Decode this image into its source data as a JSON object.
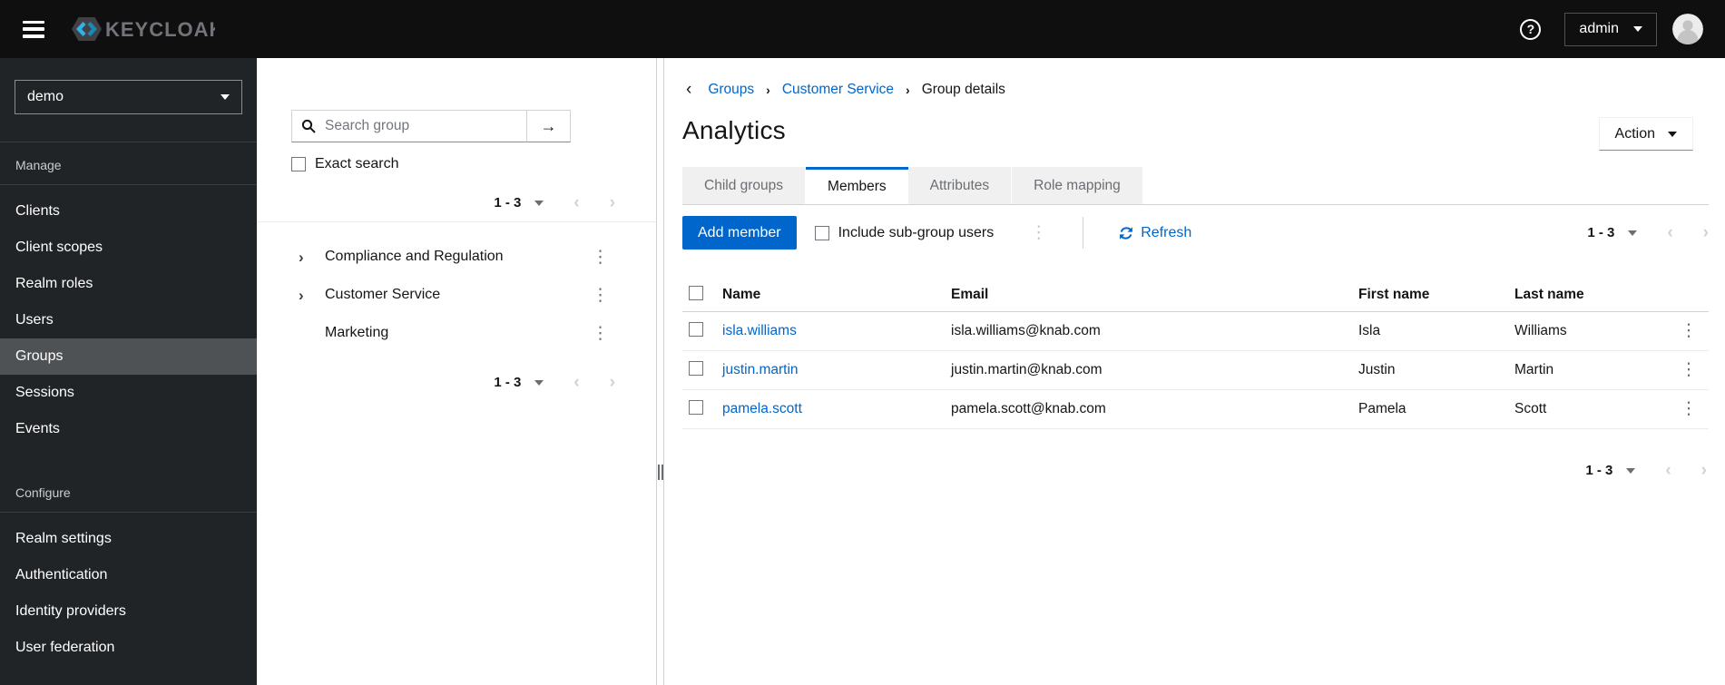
{
  "topbar": {
    "brand": "KEYCLOAK",
    "user": "admin"
  },
  "icons": {
    "kebab": "⋮",
    "angle_right": "›",
    "angle_left": "‹",
    "arrow_right": "→",
    "help": "?"
  },
  "sidebar": {
    "realm": "demo",
    "sections": {
      "manage": {
        "label": "Manage",
        "items": [
          "Clients",
          "Client scopes",
          "Realm roles",
          "Users",
          "Groups",
          "Sessions",
          "Events"
        ]
      },
      "configure": {
        "label": "Configure",
        "items": [
          "Realm settings",
          "Authentication",
          "Identity providers",
          "User federation"
        ]
      }
    },
    "active_item": "Groups"
  },
  "drawer": {
    "search": {
      "placeholder": "Search group"
    },
    "exact_search_label": "Exact search",
    "pagination": {
      "range": "1 - 3"
    },
    "tree": {
      "items": [
        {
          "label": "Compliance and Regulation",
          "expandable": true
        },
        {
          "label": "Customer Service",
          "expandable": true
        },
        {
          "label": "Marketing",
          "expandable": false
        }
      ]
    }
  },
  "main": {
    "breadcrumb": {
      "items": [
        "Groups",
        "Customer Service",
        "Group details"
      ]
    },
    "title": "Analytics",
    "action_label": "Action",
    "tabs": {
      "items": [
        "Child groups",
        "Members",
        "Attributes",
        "Role mapping"
      ],
      "active": "Members"
    },
    "toolbar": {
      "add_member_label": "Add member",
      "include_subgroups_label": "Include sub-group users",
      "refresh_label": "Refresh",
      "pagination": {
        "range": "1 - 3"
      }
    },
    "table": {
      "headers": [
        "Name",
        "Email",
        "First name",
        "Last name"
      ],
      "rows": [
        {
          "name": "isla.williams",
          "email": "isla.williams@knab.com",
          "first_name": "Isla",
          "last_name": "Williams"
        },
        {
          "name": "justin.martin",
          "email": "justin.martin@knab.com",
          "first_name": "Justin",
          "last_name": "Martin"
        },
        {
          "name": "pamela.scott",
          "email": "pamela.scott@knab.com",
          "first_name": "Pamela",
          "last_name": "Scott"
        }
      ]
    },
    "pagination": {
      "range": "1 - 3"
    }
  },
  "colors": {
    "primary": "#0066cc",
    "link": "#0066cc",
    "masthead_bg": "#0f0f0f",
    "sidebar_bg": "#212427",
    "sidebar_active_bg": "#4f5255",
    "tab_inactive_bg": "#f0f0f0",
    "active_tab_border": "#0066cc",
    "brand_accent": "#2fb3e3"
  }
}
